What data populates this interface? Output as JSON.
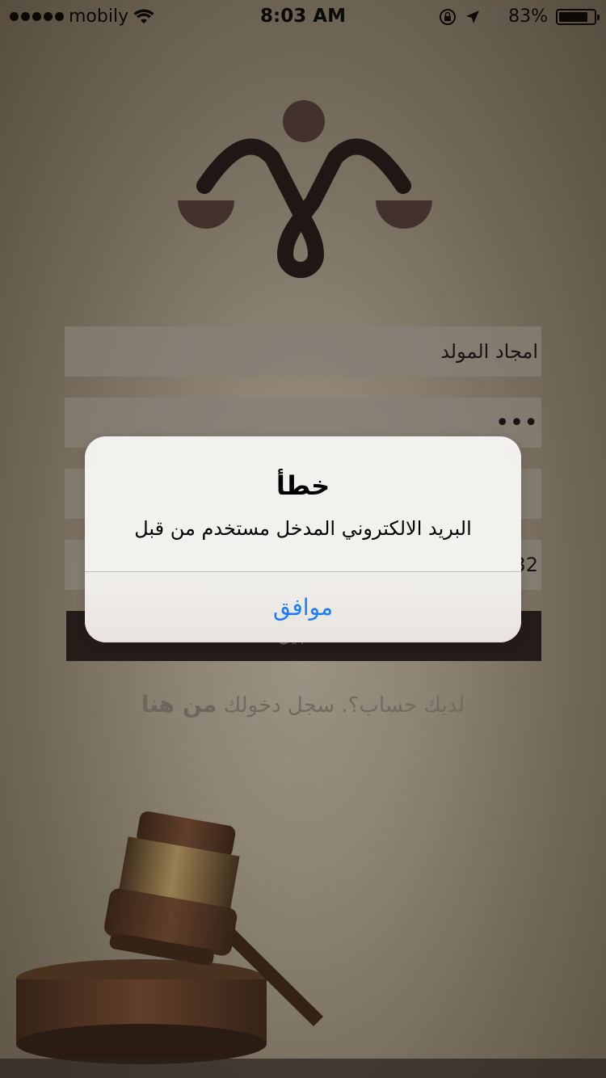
{
  "status_bar": {
    "carrier": "mobily",
    "time": "8:03 AM",
    "battery_percent": "83%",
    "battery_level": 0.83
  },
  "colors": {
    "logo_accent": "#4e3935",
    "logo_dark": "#1a1413",
    "alert_button": "#1a7dff"
  },
  "form": {
    "name_value": "امجاد المولد",
    "password_value": "•••",
    "partial_field_value": "32",
    "submit_label": "تسجيل"
  },
  "register_prompt": {
    "text": "لديك حساب؟. سجل دخولك",
    "link": "من هنا"
  },
  "alert": {
    "title": "خطأ",
    "message": "البريد الالكتروني المدخل مستخدم من قبل",
    "ok_label": "موافق"
  }
}
